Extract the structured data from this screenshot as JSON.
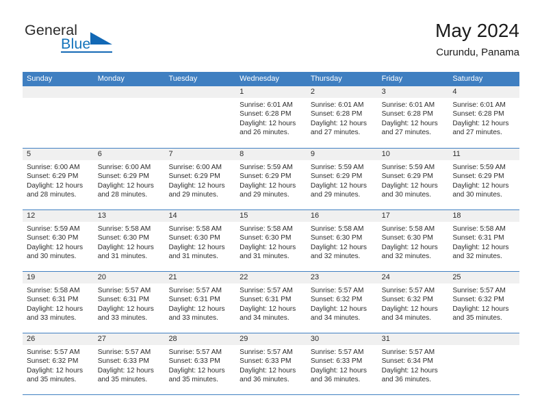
{
  "brand": {
    "line1": "General",
    "line2": "Blue",
    "triangle_icon": "triangle-icon"
  },
  "header": {
    "month_title": "May 2024",
    "location": "Curundu, Panama"
  },
  "calendar": {
    "weekdays": [
      "Sunday",
      "Monday",
      "Tuesday",
      "Wednesday",
      "Thursday",
      "Friday",
      "Saturday"
    ],
    "accent_color": "#3f7fc1",
    "day_band_color": "#f0f0f0",
    "weeks": [
      [
        {
          "day": "",
          "empty": true
        },
        {
          "day": "",
          "empty": true
        },
        {
          "day": "",
          "empty": true
        },
        {
          "day": "1",
          "sunrise": "Sunrise: 6:01 AM",
          "sunset": "Sunset: 6:28 PM",
          "daylight": "Daylight: 12 hours and 26 minutes."
        },
        {
          "day": "2",
          "sunrise": "Sunrise: 6:01 AM",
          "sunset": "Sunset: 6:28 PM",
          "daylight": "Daylight: 12 hours and 27 minutes."
        },
        {
          "day": "3",
          "sunrise": "Sunrise: 6:01 AM",
          "sunset": "Sunset: 6:28 PM",
          "daylight": "Daylight: 12 hours and 27 minutes."
        },
        {
          "day": "4",
          "sunrise": "Sunrise: 6:01 AM",
          "sunset": "Sunset: 6:28 PM",
          "daylight": "Daylight: 12 hours and 27 minutes."
        }
      ],
      [
        {
          "day": "5",
          "sunrise": "Sunrise: 6:00 AM",
          "sunset": "Sunset: 6:29 PM",
          "daylight": "Daylight: 12 hours and 28 minutes."
        },
        {
          "day": "6",
          "sunrise": "Sunrise: 6:00 AM",
          "sunset": "Sunset: 6:29 PM",
          "daylight": "Daylight: 12 hours and 28 minutes."
        },
        {
          "day": "7",
          "sunrise": "Sunrise: 6:00 AM",
          "sunset": "Sunset: 6:29 PM",
          "daylight": "Daylight: 12 hours and 29 minutes."
        },
        {
          "day": "8",
          "sunrise": "Sunrise: 5:59 AM",
          "sunset": "Sunset: 6:29 PM",
          "daylight": "Daylight: 12 hours and 29 minutes."
        },
        {
          "day": "9",
          "sunrise": "Sunrise: 5:59 AM",
          "sunset": "Sunset: 6:29 PM",
          "daylight": "Daylight: 12 hours and 29 minutes."
        },
        {
          "day": "10",
          "sunrise": "Sunrise: 5:59 AM",
          "sunset": "Sunset: 6:29 PM",
          "daylight": "Daylight: 12 hours and 30 minutes."
        },
        {
          "day": "11",
          "sunrise": "Sunrise: 5:59 AM",
          "sunset": "Sunset: 6:29 PM",
          "daylight": "Daylight: 12 hours and 30 minutes."
        }
      ],
      [
        {
          "day": "12",
          "sunrise": "Sunrise: 5:59 AM",
          "sunset": "Sunset: 6:30 PM",
          "daylight": "Daylight: 12 hours and 30 minutes."
        },
        {
          "day": "13",
          "sunrise": "Sunrise: 5:58 AM",
          "sunset": "Sunset: 6:30 PM",
          "daylight": "Daylight: 12 hours and 31 minutes."
        },
        {
          "day": "14",
          "sunrise": "Sunrise: 5:58 AM",
          "sunset": "Sunset: 6:30 PM",
          "daylight": "Daylight: 12 hours and 31 minutes."
        },
        {
          "day": "15",
          "sunrise": "Sunrise: 5:58 AM",
          "sunset": "Sunset: 6:30 PM",
          "daylight": "Daylight: 12 hours and 31 minutes."
        },
        {
          "day": "16",
          "sunrise": "Sunrise: 5:58 AM",
          "sunset": "Sunset: 6:30 PM",
          "daylight": "Daylight: 12 hours and 32 minutes."
        },
        {
          "day": "17",
          "sunrise": "Sunrise: 5:58 AM",
          "sunset": "Sunset: 6:30 PM",
          "daylight": "Daylight: 12 hours and 32 minutes."
        },
        {
          "day": "18",
          "sunrise": "Sunrise: 5:58 AM",
          "sunset": "Sunset: 6:31 PM",
          "daylight": "Daylight: 12 hours and 32 minutes."
        }
      ],
      [
        {
          "day": "19",
          "sunrise": "Sunrise: 5:58 AM",
          "sunset": "Sunset: 6:31 PM",
          "daylight": "Daylight: 12 hours and 33 minutes."
        },
        {
          "day": "20",
          "sunrise": "Sunrise: 5:57 AM",
          "sunset": "Sunset: 6:31 PM",
          "daylight": "Daylight: 12 hours and 33 minutes."
        },
        {
          "day": "21",
          "sunrise": "Sunrise: 5:57 AM",
          "sunset": "Sunset: 6:31 PM",
          "daylight": "Daylight: 12 hours and 33 minutes."
        },
        {
          "day": "22",
          "sunrise": "Sunrise: 5:57 AM",
          "sunset": "Sunset: 6:31 PM",
          "daylight": "Daylight: 12 hours and 34 minutes."
        },
        {
          "day": "23",
          "sunrise": "Sunrise: 5:57 AM",
          "sunset": "Sunset: 6:32 PM",
          "daylight": "Daylight: 12 hours and 34 minutes."
        },
        {
          "day": "24",
          "sunrise": "Sunrise: 5:57 AM",
          "sunset": "Sunset: 6:32 PM",
          "daylight": "Daylight: 12 hours and 34 minutes."
        },
        {
          "day": "25",
          "sunrise": "Sunrise: 5:57 AM",
          "sunset": "Sunset: 6:32 PM",
          "daylight": "Daylight: 12 hours and 35 minutes."
        }
      ],
      [
        {
          "day": "26",
          "sunrise": "Sunrise: 5:57 AM",
          "sunset": "Sunset: 6:32 PM",
          "daylight": "Daylight: 12 hours and 35 minutes."
        },
        {
          "day": "27",
          "sunrise": "Sunrise: 5:57 AM",
          "sunset": "Sunset: 6:33 PM",
          "daylight": "Daylight: 12 hours and 35 minutes."
        },
        {
          "day": "28",
          "sunrise": "Sunrise: 5:57 AM",
          "sunset": "Sunset: 6:33 PM",
          "daylight": "Daylight: 12 hours and 35 minutes."
        },
        {
          "day": "29",
          "sunrise": "Sunrise: 5:57 AM",
          "sunset": "Sunset: 6:33 PM",
          "daylight": "Daylight: 12 hours and 36 minutes."
        },
        {
          "day": "30",
          "sunrise": "Sunrise: 5:57 AM",
          "sunset": "Sunset: 6:33 PM",
          "daylight": "Daylight: 12 hours and 36 minutes."
        },
        {
          "day": "31",
          "sunrise": "Sunrise: 5:57 AM",
          "sunset": "Sunset: 6:34 PM",
          "daylight": "Daylight: 12 hours and 36 minutes."
        },
        {
          "day": "",
          "empty": true
        }
      ]
    ]
  }
}
